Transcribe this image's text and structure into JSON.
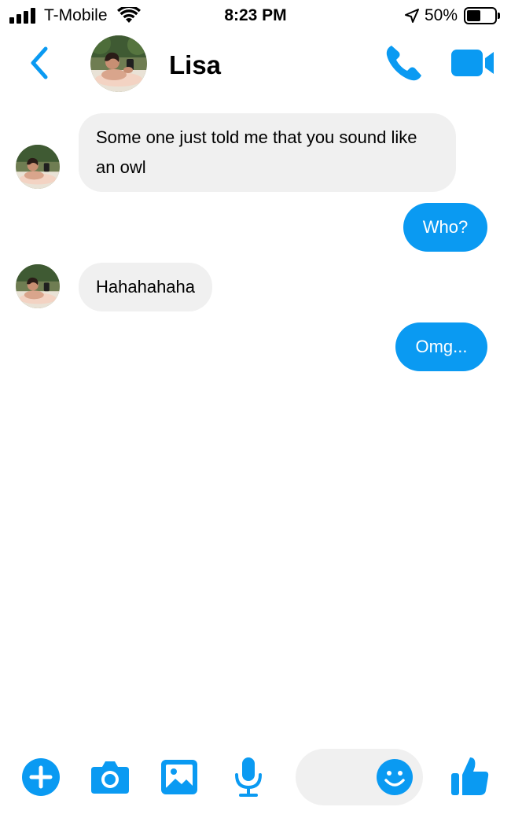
{
  "status_bar": {
    "carrier": "T-Mobile",
    "time": "8:23 PM",
    "battery_percent": "50%",
    "battery_level": 0.5,
    "icons": [
      "signal-icon",
      "wifi-icon",
      "location-arrow-icon",
      "battery-icon"
    ]
  },
  "header": {
    "contact_name": "Lisa",
    "icons": [
      "back-chevron-icon",
      "phone-icon",
      "video-camera-icon"
    ]
  },
  "messages": [
    {
      "direction": "incoming",
      "text": "Some one just told me that you sound like an owl"
    },
    {
      "direction": "outgoing",
      "text": "Who?"
    },
    {
      "direction": "incoming",
      "text": "Hahahahaha"
    },
    {
      "direction": "outgoing",
      "text": "Omg..."
    }
  ],
  "composer": {
    "placeholder": "",
    "icons": [
      "plus-icon",
      "camera-icon",
      "gallery-icon",
      "microphone-icon",
      "emoji-icon",
      "thumbs-up-icon"
    ]
  },
  "colors": {
    "accent": "#0a9af2",
    "incoming_bubble": "#f0f0f0",
    "outgoing_text": "#ffffff"
  }
}
